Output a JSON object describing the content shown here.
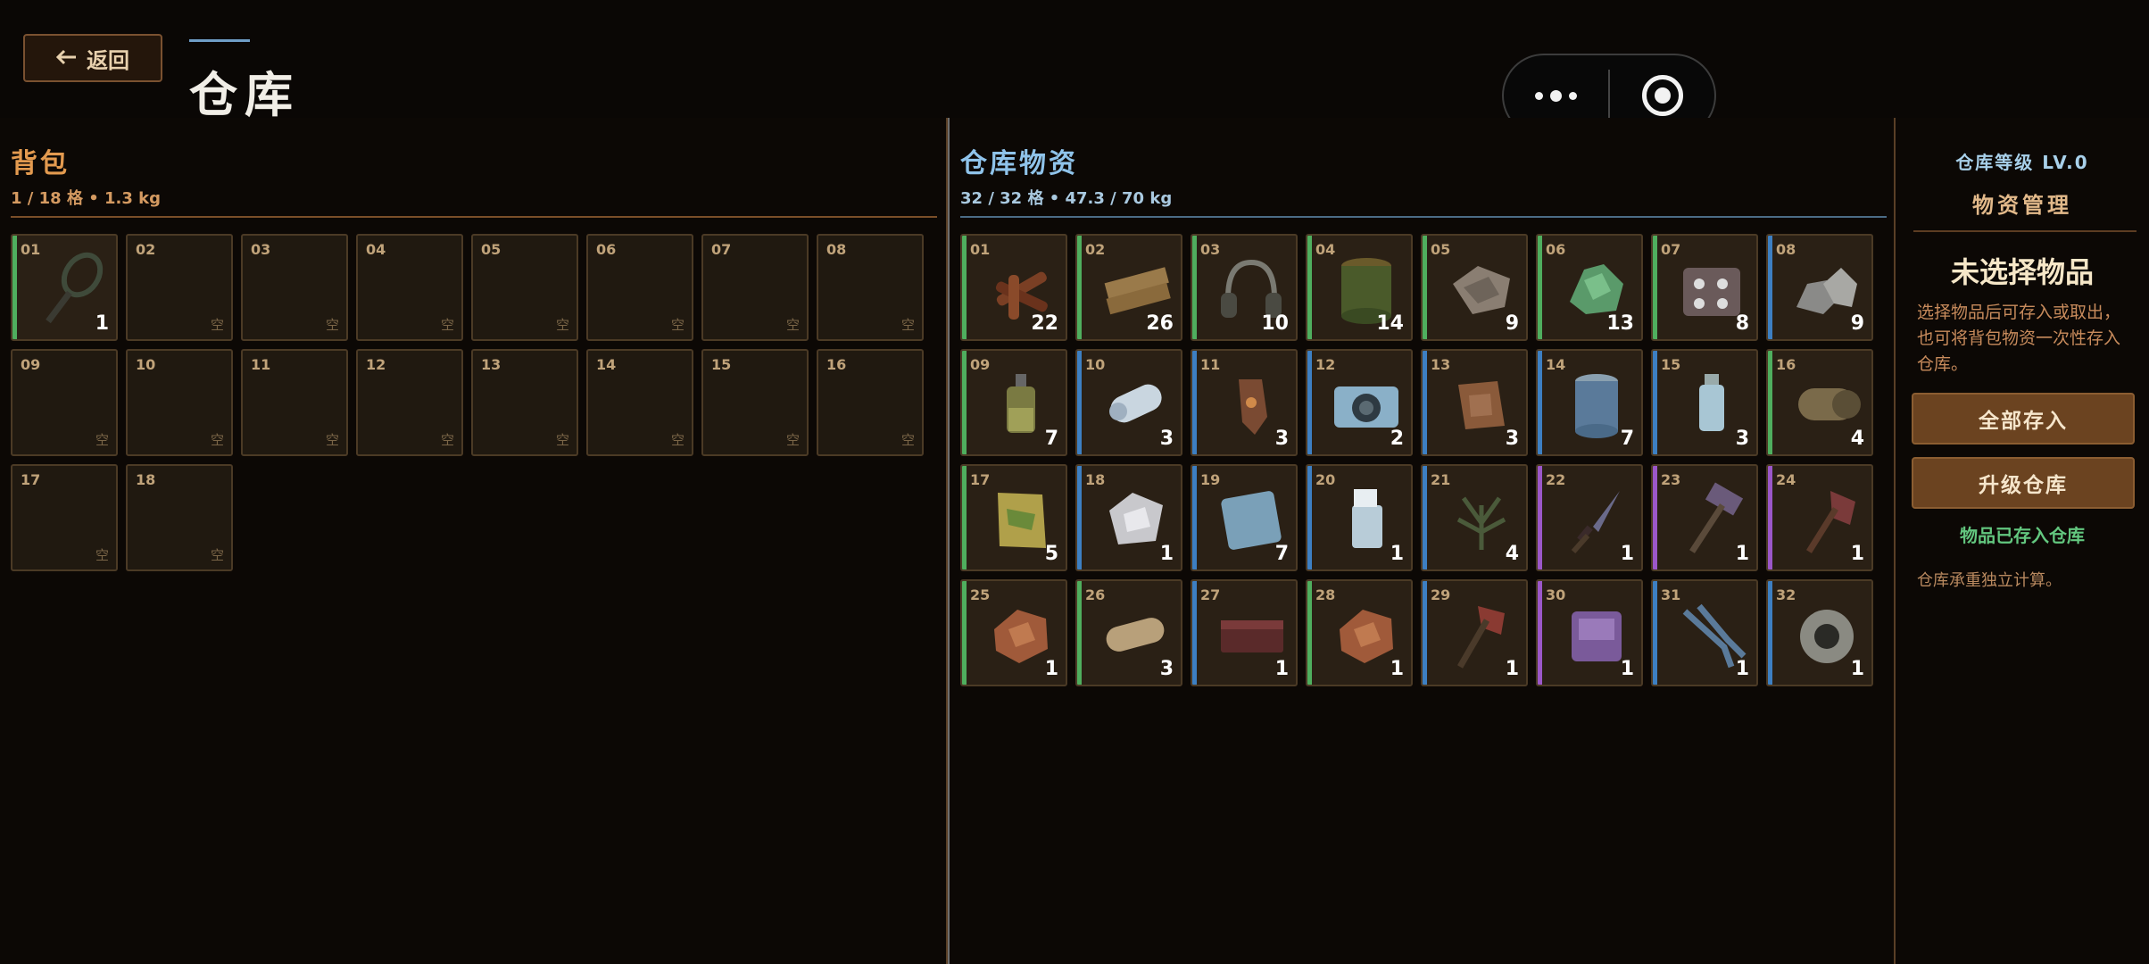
{
  "header": {
    "back_label": "返回",
    "title": "仓库"
  },
  "backpack": {
    "title": "背包",
    "summary": "1 / 18 格 • 1.3 kg",
    "empty_label": "空",
    "slots": [
      {
        "num": "01",
        "qty": "1",
        "item_icon": "racket-icon",
        "rarity": "common"
      },
      {
        "num": "02"
      },
      {
        "num": "03"
      },
      {
        "num": "04"
      },
      {
        "num": "05"
      },
      {
        "num": "06"
      },
      {
        "num": "07"
      },
      {
        "num": "08"
      },
      {
        "num": "09"
      },
      {
        "num": "10"
      },
      {
        "num": "11"
      },
      {
        "num": "12"
      },
      {
        "num": "13"
      },
      {
        "num": "14"
      },
      {
        "num": "15"
      },
      {
        "num": "16"
      },
      {
        "num": "17"
      },
      {
        "num": "18"
      }
    ]
  },
  "warehouse": {
    "title": "仓库物资",
    "summary": "32 / 32 格 • 47.3 / 70 kg",
    "slots": [
      {
        "num": "01",
        "qty": "22",
        "item_icon": "wood-sticks-icon",
        "rarity": "common"
      },
      {
        "num": "02",
        "qty": "26",
        "item_icon": "wood-planks-icon",
        "rarity": "common"
      },
      {
        "num": "03",
        "qty": "10",
        "item_icon": "headphones-icon",
        "rarity": "common"
      },
      {
        "num": "04",
        "qty": "14",
        "item_icon": "fuel-can-icon",
        "rarity": "common"
      },
      {
        "num": "05",
        "qty": "9",
        "item_icon": "cloth-scraps-icon",
        "rarity": "common"
      },
      {
        "num": "06",
        "qty": "13",
        "item_icon": "green-crystal-icon",
        "rarity": "common"
      },
      {
        "num": "07",
        "qty": "8",
        "item_icon": "electronic-parts-icon",
        "rarity": "common"
      },
      {
        "num": "08",
        "qty": "9",
        "item_icon": "stones-icon",
        "rarity": "rare"
      },
      {
        "num": "09",
        "qty": "7",
        "item_icon": "oil-bottle-icon",
        "rarity": "common"
      },
      {
        "num": "10",
        "qty": "3",
        "item_icon": "paper-roll-icon",
        "rarity": "rare"
      },
      {
        "num": "11",
        "qty": "3",
        "item_icon": "copper-ore-icon",
        "rarity": "rare"
      },
      {
        "num": "12",
        "qty": "2",
        "item_icon": "camera-icon",
        "rarity": "rare"
      },
      {
        "num": "13",
        "qty": "3",
        "item_icon": "scrap-parts-icon",
        "rarity": "rare"
      },
      {
        "num": "14",
        "qty": "7",
        "item_icon": "blue-can-icon",
        "rarity": "rare"
      },
      {
        "num": "15",
        "qty": "3",
        "item_icon": "medicine-bottle-icon",
        "rarity": "rare"
      },
      {
        "num": "16",
        "qty": "4",
        "item_icon": "rolled-fabric-icon",
        "rarity": "common"
      },
      {
        "num": "17",
        "qty": "5",
        "item_icon": "snack-bag-icon",
        "rarity": "common"
      },
      {
        "num": "18",
        "qty": "1",
        "item_icon": "foil-sheet-icon",
        "rarity": "rare"
      },
      {
        "num": "19",
        "qty": "7",
        "item_icon": "ice-block-icon",
        "rarity": "rare"
      },
      {
        "num": "20",
        "qty": "1",
        "item_icon": "lighter-icon",
        "rarity": "rare"
      },
      {
        "num": "21",
        "qty": "4",
        "item_icon": "herb-bundle-icon",
        "rarity": "rare"
      },
      {
        "num": "22",
        "qty": "1",
        "item_icon": "dagger-icon",
        "rarity": "epic"
      },
      {
        "num": "23",
        "qty": "1",
        "item_icon": "hammer-icon",
        "rarity": "epic"
      },
      {
        "num": "24",
        "qty": "1",
        "item_icon": "axe-icon",
        "rarity": "epic"
      },
      {
        "num": "25",
        "qty": "1",
        "item_icon": "meat-chunk-icon",
        "rarity": "common"
      },
      {
        "num": "26",
        "qty": "3",
        "item_icon": "bandage-roll-icon",
        "rarity": "common"
      },
      {
        "num": "27",
        "qty": "1",
        "item_icon": "brick-icon",
        "rarity": "rare"
      },
      {
        "num": "28",
        "qty": "1",
        "item_icon": "meat-chunk-icon",
        "rarity": "common"
      },
      {
        "num": "29",
        "qty": "1",
        "item_icon": "hatchet-icon",
        "rarity": "rare"
      },
      {
        "num": "30",
        "qty": "1",
        "item_icon": "purple-pack-icon",
        "rarity": "epic"
      },
      {
        "num": "31",
        "qty": "1",
        "item_icon": "pliers-icon",
        "rarity": "rare"
      },
      {
        "num": "32",
        "qty": "1",
        "item_icon": "duct-tape-icon",
        "rarity": "rare"
      }
    ]
  },
  "side": {
    "level_label": "仓库等级 LV.0",
    "section_title": "物资管理",
    "empty_title": "未选择物品",
    "hint": "选择物品后可存入或取出，也可将背包物资一次性存入仓库。",
    "store_all_label": "全部存入",
    "upgrade_label": "升级仓库",
    "status": "物品已存入仓库",
    "note": "仓库承重独立计算。"
  },
  "colors": {
    "rarity_common": "#4fae5e",
    "rarity_rare": "#3d7fc2",
    "rarity_epic": "#9b57c9",
    "accent_orange": "#e39a4f",
    "accent_blue": "#8fc3ea",
    "success_green": "#63c77f"
  }
}
